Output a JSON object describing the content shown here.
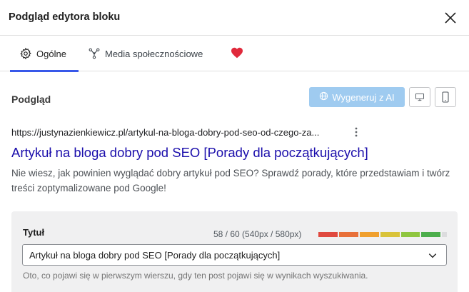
{
  "modal": {
    "title": "Podgląd edytora bloku",
    "close_icon": "close-icon"
  },
  "tabs": [
    {
      "label": "Ogólne",
      "icon": "gear-icon",
      "active": true
    },
    {
      "label": "Media społecznościowe",
      "icon": "share-icon",
      "active": false
    },
    {
      "label": "",
      "icon": "heart-icon",
      "active": false
    }
  ],
  "preview": {
    "heading": "Podgląd",
    "ai_button_label": "Wygeneruj z AI",
    "ai_button_icon": "globe-icon",
    "device_buttons": [
      "desktop-icon",
      "mobile-icon"
    ]
  },
  "serp": {
    "url": "https://justynazienkiewicz.pl/artykul-na-bloga-dobry-pod-seo-od-czego-za...",
    "title": "Artykuł na bloga dobry pod SEO [Porady dla początkujących]",
    "description": "Nie wiesz, jak powinien wyglądać dobry artykuł pod SEO? Sprawdź porady, które przedstawiam i twórz treści zoptymalizowane pod Google!"
  },
  "title_field": {
    "label": "Tytuł",
    "counter": "58 / 60 (540px / 580px)",
    "length_fraction": 0.93,
    "value": "Artykuł na bloga dobry pod SEO [Porady dla początkujących]",
    "help": "Oto, co pojawi się w pierwszym wierszu, gdy ten post pojawi się w wynikach wyszukiwania."
  },
  "colors": {
    "accent": "#3858e9",
    "link": "#1a0dab",
    "heart": "#e0293b",
    "meter": [
      "#e0493f",
      "#e8703a",
      "#f0a02e",
      "#d9c33a",
      "#8fc640",
      "#4cae4c",
      "#dcdcde"
    ]
  }
}
